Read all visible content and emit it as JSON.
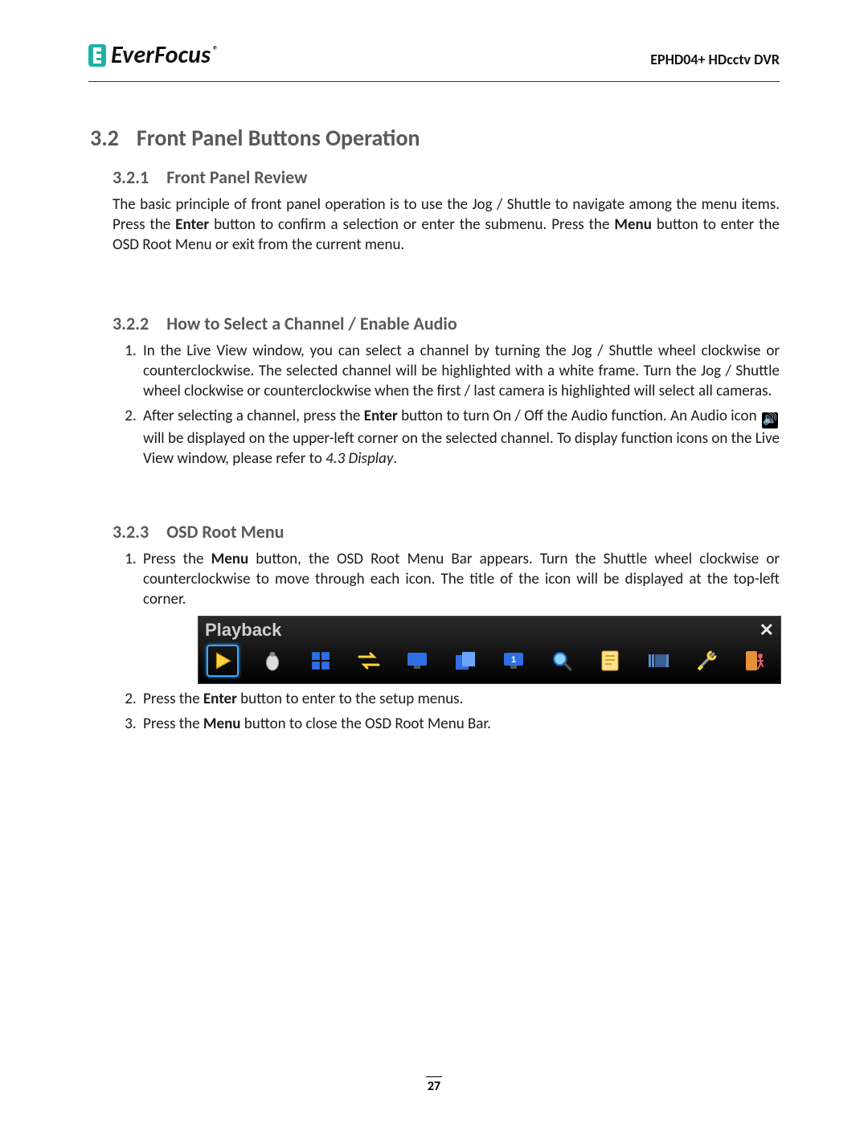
{
  "header": {
    "brand_name": "EverFocus",
    "brand_reg": "®",
    "product_label": "EPHD04+  HDcctv DVR"
  },
  "sec32": {
    "num": "3.2",
    "title": "Front Panel Buttons Operation"
  },
  "sec321": {
    "num": "3.2.1",
    "title": "Front Panel Review",
    "para_a": "The basic principle of front panel operation is to use the Jog / Shuttle to navigate among the menu items. Press the ",
    "enter": "Enter",
    "para_b": " button to confirm a selection or enter the submenu. Press the ",
    "menu": "Menu",
    "para_c": " button to enter the OSD Root Menu or exit from the current menu."
  },
  "sec322": {
    "num": "3.2.2",
    "title": "How to Select a Channel / Enable Audio",
    "item1": "In the Live View window, you can select a channel by turning the Jog / Shuttle wheel clockwise or counterclockwise. The selected channel will be highlighted with a white frame. Turn the Jog / Shuttle wheel clockwise or counterclockwise when the first / last camera is highlighted will select all cameras.",
    "item2_a": "After selecting a channel, press the ",
    "item2_enter": "Enter",
    "item2_b": " button to turn On / Off the Audio function. An Audio icon ",
    "item2_c": " will be displayed on the upper-left corner on the selected channel. To display function icons on the Live View window, please refer to ",
    "item2_ref": "4.3 Display",
    "item2_d": "."
  },
  "sec323": {
    "num": "3.2.3",
    "title": "OSD Root Menu",
    "item1_a": "Press the ",
    "item1_menu": "Menu",
    "item1_b": " button, the OSD Root Menu Bar appears. Turn the Shuttle wheel clockwise or counterclockwise to move through each icon. The title of the icon will be displayed at the top-left corner.",
    "item2_a": "Press the ",
    "item2_enter": "Enter",
    "item2_b": " button to enter to the setup menus.",
    "item3_a": "Press the ",
    "item3_menu": "Menu",
    "item3_b": " button to close the OSD Root Menu Bar."
  },
  "osd": {
    "title": "Playback",
    "icons": [
      "playback",
      "camera",
      "multiview",
      "sequence",
      "display",
      "copy",
      "record",
      "search",
      "event",
      "schedule",
      "tools",
      "logout"
    ]
  },
  "footer": {
    "page_num": "27"
  }
}
